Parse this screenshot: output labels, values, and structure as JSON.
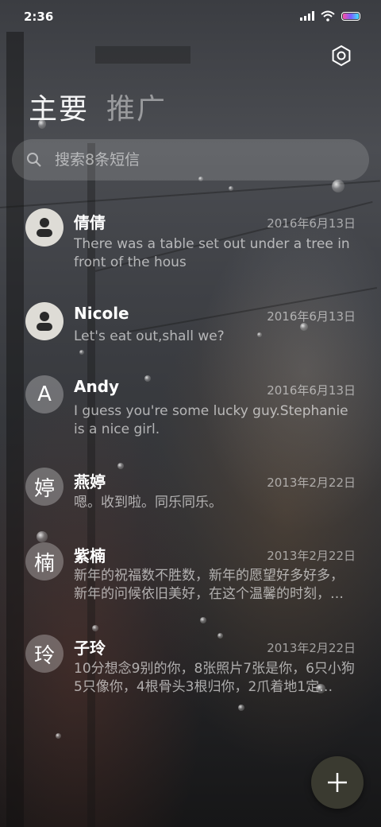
{
  "status_bar": {
    "time": "2:36",
    "icons": [
      "signal-icon",
      "wifi-icon",
      "battery-icon"
    ]
  },
  "header": {
    "settings_icon": "gear-icon",
    "tabs": [
      {
        "label": "主要",
        "active": true
      },
      {
        "label": "推广",
        "active": false
      }
    ]
  },
  "search": {
    "placeholder": "搜索8条短信",
    "icon": "search-icon"
  },
  "conversations": [
    {
      "name": "倩倩",
      "avatar": "contact",
      "avatar_text": "",
      "date": "2016年6月13日",
      "snippet": "There was a table set out under a tree in front of the hous"
    },
    {
      "name": "Nicole",
      "avatar": "contact",
      "avatar_text": "",
      "date": "2016年6月13日",
      "snippet": "Let's eat out,shall we?"
    },
    {
      "name": "Andy",
      "avatar": "letter",
      "avatar_text": "A",
      "date": "2016年6月13日",
      "snippet": "I guess you're some lucky guy.Stephanie is a nice girl."
    },
    {
      "name": "燕婷",
      "avatar": "letter",
      "avatar_text": "婷",
      "date": "2013年2月22日",
      "snippet": "嗯。收到啦。同乐同乐。"
    },
    {
      "name": "紫楠",
      "avatar": "letter",
      "avatar_text": "楠",
      "date": "2013年2月22日",
      "snippet": "新年的祝福数不胜数，新年的愿望好多好多，新年的问候依旧美好，在这个温馨的时刻，…"
    },
    {
      "name": "子玲",
      "avatar": "letter",
      "avatar_text": "玲",
      "date": "2013年2月22日",
      "snippet": "10分想念9别的你，8张照片7张是你，6只小狗5只像你，4根骨头3根归你，2爪着地1定…"
    }
  ],
  "fab": {
    "icon": "plus-icon"
  },
  "colors": {
    "fab_background": "#3a3a30",
    "contact_avatar": "#dedcd6"
  }
}
